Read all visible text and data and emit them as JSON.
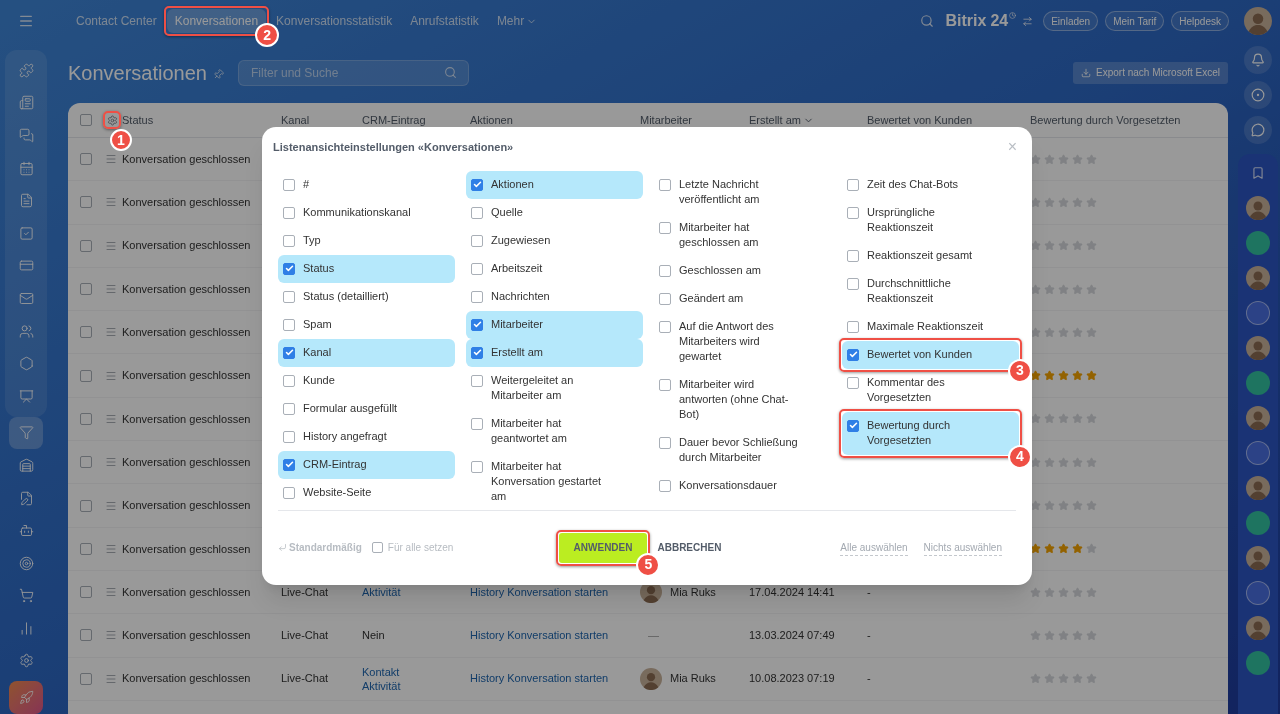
{
  "header": {
    "nav": [
      {
        "label": "Contact Center",
        "selected": false,
        "kind": "link"
      },
      {
        "label": "Konversationen",
        "selected": true,
        "kind": "link",
        "callout": "2"
      },
      {
        "label": "Konversationsstatistik",
        "selected": false,
        "kind": "link"
      },
      {
        "label": "Anrufstatistik",
        "selected": false,
        "kind": "link"
      },
      {
        "label": "Mehr",
        "selected": false,
        "kind": "menu"
      }
    ],
    "logo": {
      "name": "Bitrix",
      "version": "24"
    },
    "buttons": [
      "Einladen",
      "Mein Tarif",
      "Helpdesk"
    ]
  },
  "left_nav": [
    {
      "selected": false
    },
    {
      "selected": false
    },
    {
      "selected": false
    },
    {
      "selected": false
    },
    {
      "selected": false
    },
    {
      "selected": false
    },
    {
      "selected": false
    },
    {
      "selected": false
    },
    {
      "selected": false
    },
    {
      "selected": false
    },
    {
      "selected": false
    },
    {
      "selected": true
    },
    {
      "selected": false
    },
    {
      "selected": false
    },
    {
      "selected": false
    },
    {
      "selected": false
    },
    {
      "selected": false
    },
    {
      "selected": false
    },
    {
      "selected": false
    },
    {
      "selected": false
    }
  ],
  "page": {
    "title": "Konversationen",
    "search": {
      "placeholder": "Filter und Suche"
    },
    "export_button": "Export nach Microsoft Excel"
  },
  "table": {
    "all_checked": false,
    "settings_callout": "1",
    "columns": [
      {
        "label": "Status",
        "sorted": false
      },
      {
        "label": "Kanal",
        "sorted": false
      },
      {
        "label": "CRM-Eintrag",
        "sorted": false
      },
      {
        "label": "Aktionen",
        "sorted": false
      },
      {
        "label": "Mitarbeiter",
        "sorted": false
      },
      {
        "label": "Erstellt am",
        "sorted": true
      },
      {
        "label": "Bewertet von Kunden",
        "sorted": false
      },
      {
        "label": "Bewertung durch Vorgesetzten",
        "sorted": false
      }
    ],
    "rows": [
      {
        "checked": false,
        "status": "Konversation geschlossen",
        "stars": 0
      },
      {
        "checked": false,
        "status": "Konversation geschlossen",
        "stars": 0
      },
      {
        "checked": false,
        "status": "Konversation geschlossen",
        "stars": 0
      },
      {
        "checked": false,
        "status": "Konversation geschlossen",
        "stars": 0
      },
      {
        "checked": false,
        "status": "Konversation geschlossen",
        "stars": 0
      },
      {
        "checked": false,
        "status": "Konversation geschlossen",
        "stars": 5
      },
      {
        "checked": false,
        "status": "Konversation geschlossen",
        "stars": 0
      },
      {
        "checked": false,
        "status": "Konversation geschlossen",
        "stars": 0
      },
      {
        "checked": false,
        "status": "Konversation geschlossen",
        "stars": 0
      },
      {
        "checked": false,
        "status": "Konversation geschlossen",
        "stars": 4
      },
      {
        "checked": false,
        "status": "Konversation geschlossen",
        "kanal": "Live-Chat",
        "crm": [
          {
            "kind": "link",
            "text": "Aktivität"
          }
        ],
        "aktion": "History Konversation starten",
        "mitarbeiter": {
          "kind": "avatar",
          "name": "Mia Ruks"
        },
        "erstellt": "17.04.2024 14:41",
        "bewertet": "-",
        "stars": 0
      },
      {
        "checked": false,
        "status": "Konversation geschlossen",
        "kanal": "Live-Chat",
        "crm": [
          {
            "kind": "text",
            "text": "Nein"
          }
        ],
        "aktion": "History Konversation starten",
        "mitarbeiter": {
          "kind": "empty",
          "name": "—"
        },
        "erstellt": "13.03.2024 07:49",
        "bewertet": "-",
        "stars": 0
      },
      {
        "checked": false,
        "status": "Konversation geschlossen",
        "kanal": "Live-Chat",
        "crm": [
          {
            "kind": "link",
            "text": "Kontakt"
          },
          {
            "kind": "link",
            "text": "Aktivität"
          }
        ],
        "aktion": "History Konversation starten",
        "mitarbeiter": {
          "kind": "avatar",
          "name": "Mia Ruks"
        },
        "erstellt": "10.08.2023 07:19",
        "bewertet": "-",
        "stars": 0
      }
    ]
  },
  "dialog": {
    "title": "Listenansichteinstellungen «Konversationen»",
    "close": "×",
    "columns": [
      [
        {
          "label": "#",
          "checked": false
        },
        {
          "label": "Kommunikationskanal",
          "checked": false
        },
        {
          "label": "Typ",
          "checked": false
        },
        {
          "label": "Status",
          "checked": true
        },
        {
          "label": "Status (detailliert)",
          "checked": false
        },
        {
          "label": "Spam",
          "checked": false
        },
        {
          "label": "Kanal",
          "checked": true
        },
        {
          "label": "Kunde",
          "checked": false
        },
        {
          "label": "Formular ausgefüllt",
          "checked": false
        },
        {
          "label": "History angefragt",
          "checked": false
        },
        {
          "label": "CRM-Eintrag",
          "checked": true
        },
        {
          "label": "Website-Seite",
          "checked": false
        }
      ],
      [
        {
          "label": "Aktionen",
          "checked": true
        },
        {
          "label": "Quelle",
          "checked": false
        },
        {
          "label": "Zugewiesen",
          "checked": false
        },
        {
          "label": "Arbeitszeit",
          "checked": false
        },
        {
          "label": "Nachrichten",
          "checked": false
        },
        {
          "label": "Mitarbeiter",
          "checked": true
        },
        {
          "label": "Erstellt am",
          "checked": true
        },
        {
          "label": "Weitergeleitet an Mitarbeiter am",
          "checked": false
        },
        {
          "label": "Mitarbeiter hat geantwortet am",
          "checked": false
        },
        {
          "label": "Mitarbeiter hat Konversation gestartet am",
          "checked": false
        }
      ],
      [
        {
          "label": "Letzte Nachricht veröffentlicht am",
          "checked": false
        },
        {
          "label": "Mitarbeiter hat geschlossen am",
          "checked": false
        },
        {
          "label": "Geschlossen am",
          "checked": false
        },
        {
          "label": "Geändert am",
          "checked": false
        },
        {
          "label": "Auf die Antwort des Mitarbeiters wird gewartet",
          "checked": false
        },
        {
          "label": "Mitarbeiter wird antworten (ohne Chat-Bot)",
          "checked": false
        },
        {
          "label": "Dauer bevor Schließung durch Mitarbeiter",
          "checked": false
        },
        {
          "label": "Konversationsdauer",
          "checked": false
        }
      ],
      [
        {
          "label": "Zeit des Chat-Bots",
          "checked": false
        },
        {
          "label": "Ursprüngliche Reaktionszeit",
          "checked": false
        },
        {
          "label": "Reaktionszeit gesamt",
          "checked": false
        },
        {
          "label": "Durchschnittliche Reaktionszeit",
          "checked": false
        },
        {
          "label": "Maximale Reaktionszeit",
          "checked": false
        },
        {
          "label": "Bewertet von Kunden",
          "checked": true,
          "callout": "3"
        },
        {
          "label": "Kommentar des Vorgesetzten",
          "checked": false
        },
        {
          "label": "Bewertung durch Vorgesetzten",
          "checked": true,
          "callout": "4"
        }
      ]
    ],
    "reset": {
      "label": "Standardmäßig",
      "disabled": true
    },
    "for_all": {
      "label": "Für alle setzen",
      "checked": false
    },
    "apply": {
      "label": "ANWENDEN",
      "callout": "5"
    },
    "cancel": "ABBRECHEN",
    "select_all": "Alle auswählen",
    "select_none": "Nichts auswählen"
  }
}
